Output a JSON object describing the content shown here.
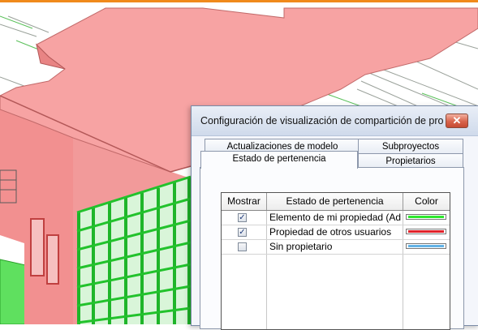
{
  "dialog": {
    "title": "Configuración de visualización de compartición de pro...",
    "tabs_back": [
      "Actualizaciones de modelo",
      "Subproyectos"
    ],
    "tabs_front": [
      "Estado de pertenencia",
      "Propietarios"
    ],
    "active_tab": "Estado de pertenencia",
    "table": {
      "headers": {
        "show": "Mostrar",
        "state": "Estado de pertenencia",
        "color": "Color"
      },
      "rows": [
        {
          "checked": true,
          "label": "Elemento de mi propiedad (Ad",
          "color": "#2ee82e"
        },
        {
          "checked": true,
          "label": "Propiedad de otros usuarios",
          "color": "#e0222a"
        },
        {
          "checked": false,
          "label": "Sin propietario",
          "color": "#63b3e6"
        }
      ]
    }
  },
  "colors": {
    "accent_bar": "#f08a1c",
    "roof": "#f4a0a0",
    "wall": "#f08a8a",
    "glazing_frame": "#22c22c"
  },
  "icons": {
    "close": "close-icon",
    "check": "check-icon"
  }
}
